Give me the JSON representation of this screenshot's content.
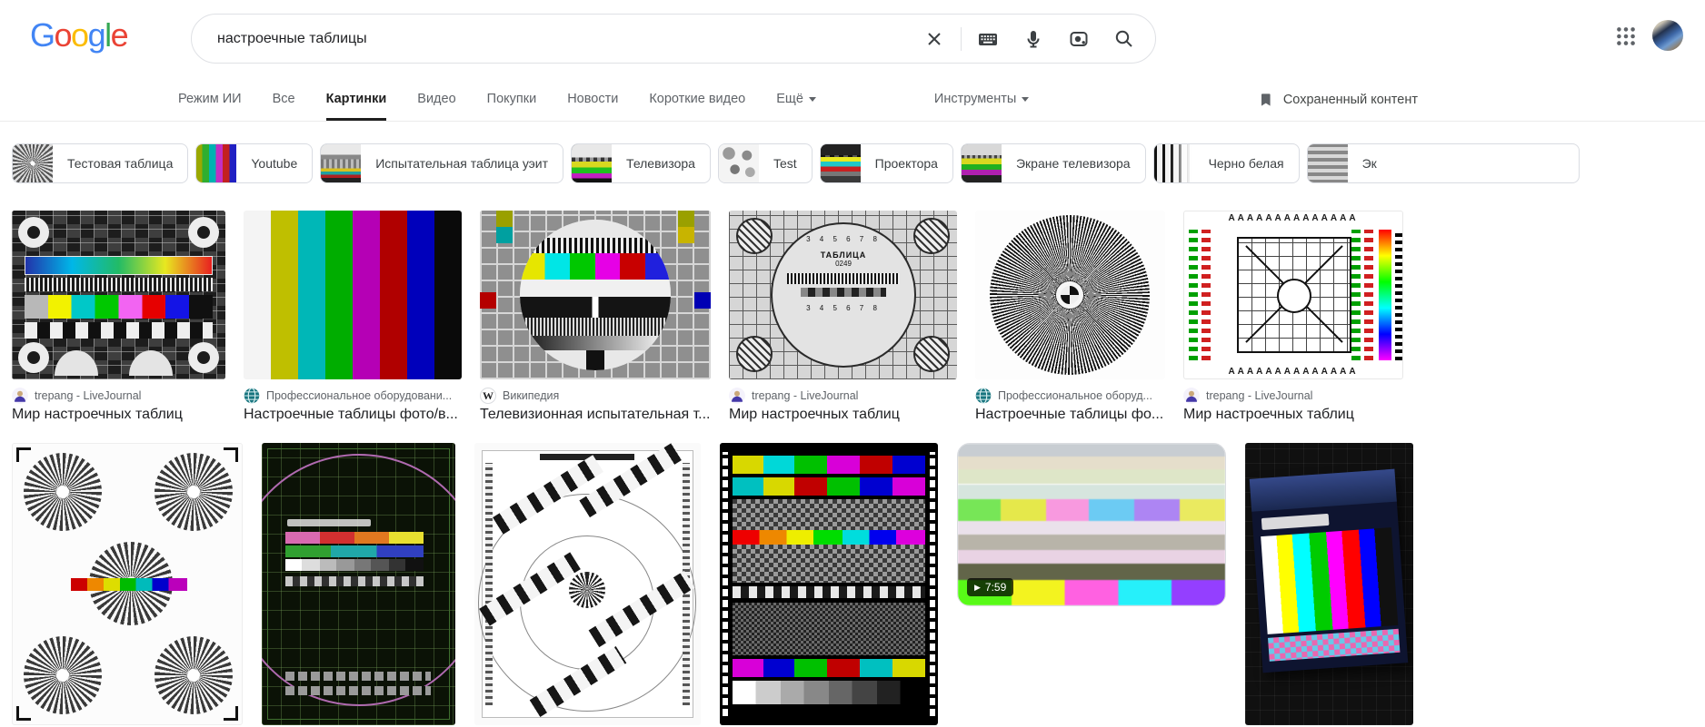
{
  "logo": {
    "letters": [
      "G",
      "o",
      "o",
      "g",
      "l",
      "e"
    ],
    "colors": [
      "#4285F4",
      "#EA4335",
      "#FBBC05",
      "#4285F4",
      "#34A853",
      "#EA4335"
    ]
  },
  "search": {
    "query": "настроечные таблицы"
  },
  "tabs": [
    {
      "label": "Режим ИИ",
      "active": false
    },
    {
      "label": "Все",
      "active": false
    },
    {
      "label": "Картинки",
      "active": true
    },
    {
      "label": "Видео",
      "active": false
    },
    {
      "label": "Покупки",
      "active": false
    },
    {
      "label": "Новости",
      "active": false
    },
    {
      "label": "Короткие видео",
      "active": false
    },
    {
      "label": "Ещё",
      "active": false
    }
  ],
  "tools": {
    "label": "Инструменты"
  },
  "saved": {
    "label": "Сохраненный контент"
  },
  "chips": [
    {
      "label": "Тестовая таблица"
    },
    {
      "label": "Youtube"
    },
    {
      "label": "Испытательная таблица уэит"
    },
    {
      "label": "Телевизора"
    },
    {
      "label": "Test"
    },
    {
      "label": "Проектора"
    },
    {
      "label": "Экране телевизора"
    },
    {
      "label": "Черно белая"
    },
    {
      "label": "Эк"
    }
  ],
  "row1": [
    {
      "source": "trepang - LiveJournal",
      "title": "Мир настроечных таблиц",
      "favicon": "livejournal"
    },
    {
      "source": "Профессиональное оборудовани...",
      "title": "Настроечные таблицы фото/в...",
      "favicon": "globe"
    },
    {
      "source": "Википедия",
      "title": "Телевизионная испытательная т...",
      "favicon": "wikipedia",
      "favicon_letter": "W"
    },
    {
      "source": "trepang - LiveJournal",
      "title": "Мир настроечных таблиц",
      "favicon": "livejournal"
    },
    {
      "source": "Профессиональное оборуд...",
      "title": "Настроечные таблицы фо...",
      "favicon": "globe"
    },
    {
      "source": "trepang - LiveJournal",
      "title": "Мир настроечных таблиц",
      "favicon": "livejournal"
    }
  ],
  "row2": [
    {},
    {},
    {},
    {},
    {
      "duration": "7:59"
    },
    {}
  ],
  "icons": {
    "play": "▶"
  },
  "image_texts": {
    "ueit_title": "ТАБЛИЦА",
    "ueit_code": "0249",
    "ueit_scale": "3 4 5 6 7 8",
    "aaa_row": "AAAAAAAAAAAAAA"
  },
  "colors": {
    "accent_blue": "#4285F4",
    "brand_red": "#EA4335",
    "brand_yellow": "#FBBC05",
    "brand_green": "#34A853",
    "text_primary": "#202124",
    "text_secondary": "#5f6368",
    "border": "#dfe1e5"
  }
}
